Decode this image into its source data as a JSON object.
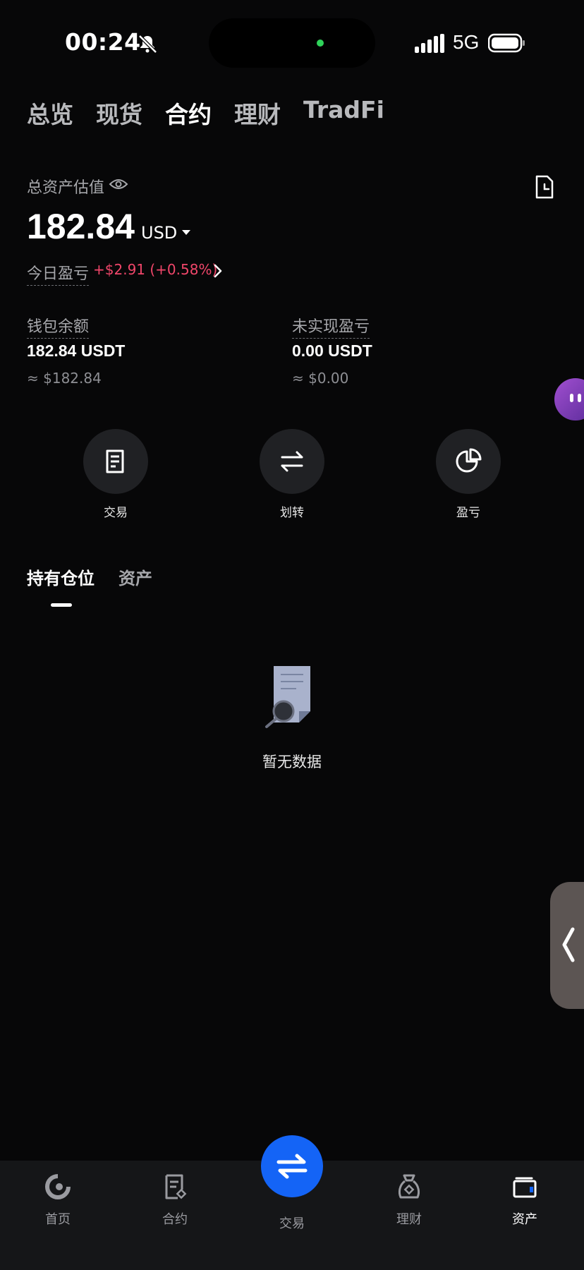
{
  "status_bar": {
    "time": "00:24",
    "network": "5G"
  },
  "top_tabs": [
    {
      "label": "总览",
      "active": false
    },
    {
      "label": "现货",
      "active": false
    },
    {
      "label": "合约",
      "active": true
    },
    {
      "label": "理财",
      "active": false
    },
    {
      "label": "TradFi",
      "active": false
    }
  ],
  "summary": {
    "total_label": "总资产估值",
    "balance": "182.84",
    "currency": "USD",
    "pnl_label": "今日盈亏",
    "pnl_value": "+$2.91 (+0.58%)"
  },
  "wallet": {
    "label": "钱包余额",
    "value": "182.84 USDT",
    "approx": "≈ $182.84"
  },
  "unrealized": {
    "label": "未实现盈亏",
    "value": "0.00 USDT",
    "approx": "≈ $0.00"
  },
  "actions": [
    {
      "label": "交易",
      "icon": "trade-doc-icon"
    },
    {
      "label": "划转",
      "icon": "transfer-icon"
    },
    {
      "label": "盈亏",
      "icon": "pie-chart-icon"
    }
  ],
  "sub_tabs": [
    {
      "label": "持有仓位",
      "active": true
    },
    {
      "label": "资产",
      "active": false
    }
  ],
  "empty": {
    "text": "暂无数据"
  },
  "bottom_nav": [
    {
      "label": "首页",
      "icon": "home-icon",
      "active": false
    },
    {
      "label": "合约",
      "icon": "contract-icon",
      "active": false
    },
    {
      "label": "交易",
      "icon": "swap-icon",
      "active": false
    },
    {
      "label": "理财",
      "icon": "finance-icon",
      "active": false
    },
    {
      "label": "资产",
      "icon": "wallet-icon",
      "active": true
    }
  ],
  "colors": {
    "accent": "#1464f6",
    "positive": "#f0466a",
    "background": "#070708"
  }
}
